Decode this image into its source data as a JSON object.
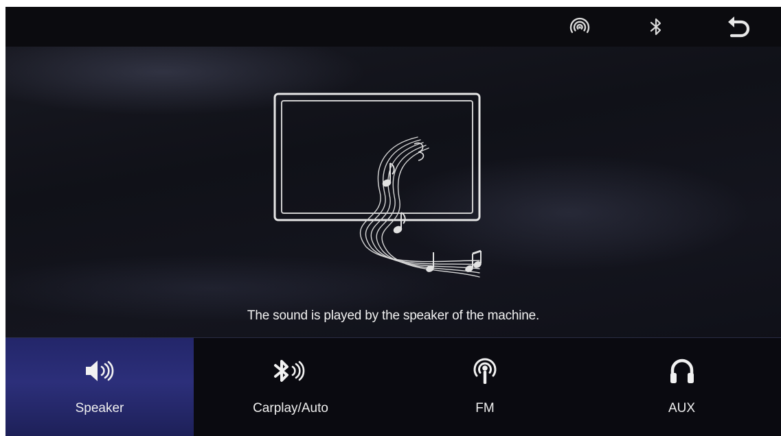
{
  "status_bar": {
    "icons": [
      "hotspot-icon",
      "bluetooth-icon",
      "back-icon"
    ]
  },
  "main": {
    "message": "The sound is played by the speaker of the machine."
  },
  "tabs": [
    {
      "label": "Speaker",
      "icon": "speaker-icon",
      "active": true
    },
    {
      "label": "Carplay/Auto",
      "icon": "bluetooth-audio-icon",
      "active": false
    },
    {
      "label": "FM",
      "icon": "fm-radio-icon",
      "active": false
    },
    {
      "label": "AUX",
      "icon": "headphones-icon",
      "active": false
    }
  ],
  "colors": {
    "active_tab": "#2c2f7a",
    "background": "#101118",
    "text": "#f2f2f2"
  }
}
